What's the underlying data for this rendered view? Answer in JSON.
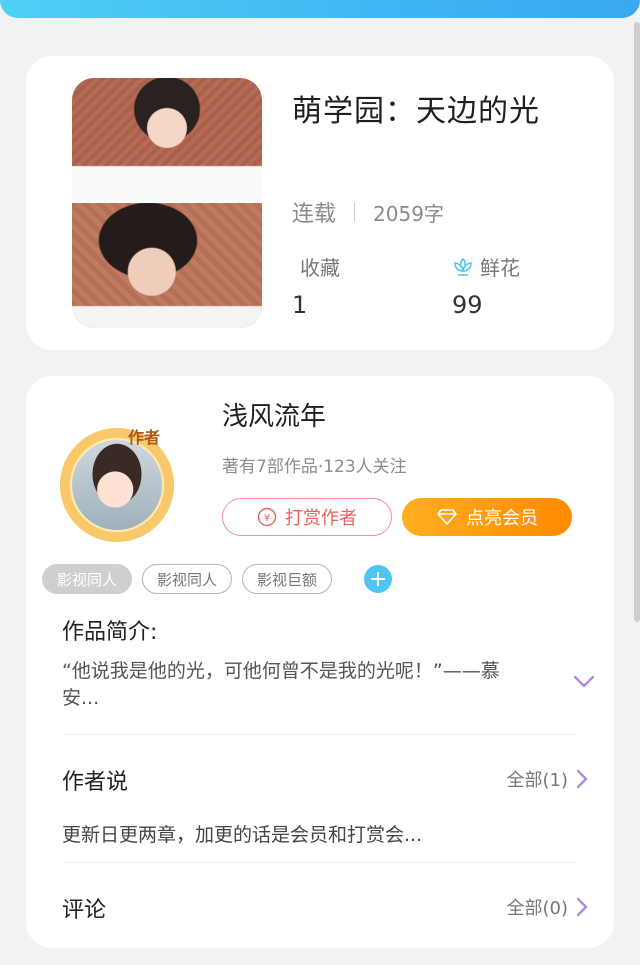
{
  "book": {
    "title": "萌学园：天边的光",
    "status": "连载",
    "word_count": "2059字",
    "favorites_label": "收藏",
    "favorites_value": "1",
    "flowers_label": "鲜花",
    "flowers_value": "99"
  },
  "author": {
    "name": "浅风流年",
    "avatar_badge": "作者",
    "meta": "著有7部作品·123人关注",
    "tip_label": "打赏作者",
    "vip_label": "点亮会员"
  },
  "tags": [
    "影视同人",
    "影视同人",
    "影视巨额"
  ],
  "add_tag_symbol": "+",
  "intro": {
    "title": "作品简介:",
    "text": "“他说我是他的光，可他何曾不是我的光呢！”——慕安..."
  },
  "author_says": {
    "title": "作者说",
    "more": "全部(1)",
    "text": "更新日更两章，加更的话是会员和打赏会..."
  },
  "comments": {
    "title": "评论",
    "more": "全部(0)"
  },
  "colors": {
    "accent_blue": "#4fc6f2",
    "tip_red": "#e8625c",
    "vip_orange": "#ff8a00",
    "chevron_purple": "#b08ad8"
  }
}
